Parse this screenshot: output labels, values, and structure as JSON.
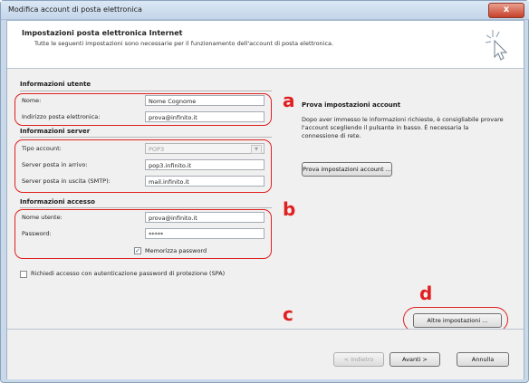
{
  "window": {
    "title": "Modifica account di posta elettronica",
    "close_glyph": "x"
  },
  "header": {
    "title": "Impostazioni posta elettronica Internet",
    "subtitle": "Tutte le seguenti impostazioni sono necessarie per il funzionamento dell'account di posta elettronica."
  },
  "user_info": {
    "heading": "Informazioni utente",
    "name_label": "Nome:",
    "name_value": "Nome Cognome",
    "email_label": "Indirizzo posta elettronica:",
    "email_value": "prova@infinito.it"
  },
  "server_info": {
    "heading": "Informazioni server",
    "account_type_label": "Tipo account:",
    "account_type_value": "POP3",
    "incoming_label": "Server posta in arrivo:",
    "incoming_value": "pop3.infinito.it",
    "outgoing_label": "Server posta in uscita (SMTP):",
    "outgoing_value": "mail.infinito.it"
  },
  "logon_info": {
    "heading": "Informazioni accesso",
    "username_label": "Nome utente:",
    "username_value": "prova@infinito.it",
    "password_label": "Password:",
    "password_value": "*****",
    "remember_label": "Memorizza password",
    "remember_checked": true,
    "spa_label": "Richiedi accesso con autenticazione password di protezione (SPA)",
    "spa_checked": false
  },
  "test": {
    "heading": "Prova impostazioni account",
    "description": "Dopo aver immesso le informazioni richieste, è consigliabile provare l'account scegliendo il pulsante in basso. È necessaria la connessione di rete.",
    "test_button": "Prova impostazioni account ...",
    "more_settings_button": "Altre impostazioni ..."
  },
  "footer": {
    "back_button": "< Indietro",
    "next_button": "Avanti >",
    "cancel_button": "Annulla"
  },
  "annotations": {
    "a": "a",
    "b": "b",
    "c": "c",
    "d": "d",
    "color": "#e02020"
  }
}
